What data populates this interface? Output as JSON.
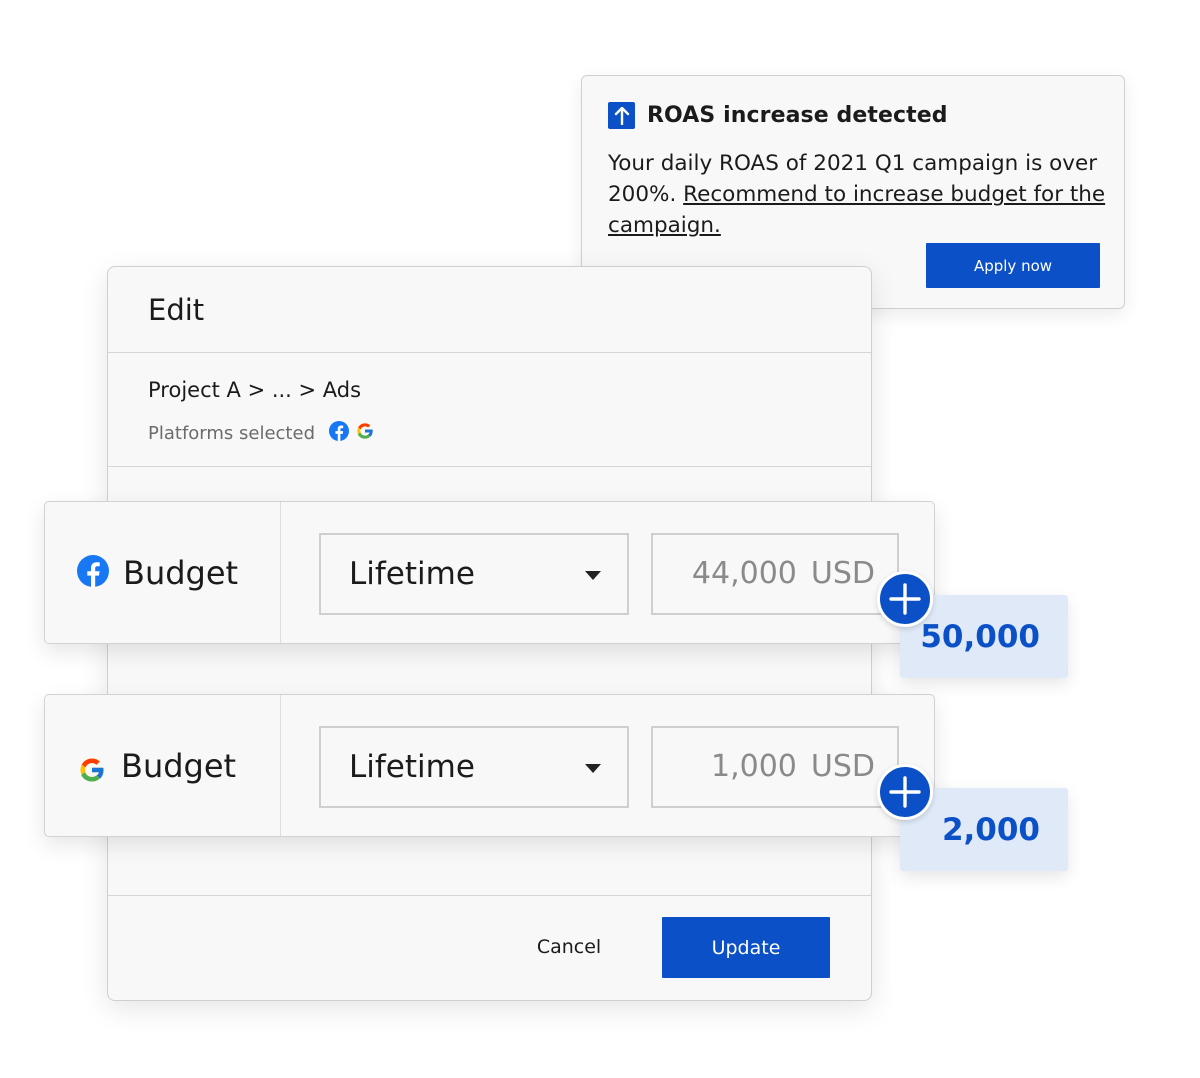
{
  "notification": {
    "title": "ROAS increase detected",
    "message": "Your daily ROAS of 2021 Q1 campaign is over 200%. ",
    "link_text": "Recommend to increase budget for the campaign.",
    "apply_label": "Apply now",
    "icon": "arrow-up-icon"
  },
  "edit": {
    "title": "Edit",
    "breadcrumb": "Project A > ... > Ads",
    "platforms_label": "Platforms selected",
    "cancel_label": "Cancel",
    "update_label": "Update"
  },
  "budgets": [
    {
      "platform_icon": "facebook-icon",
      "label": "Budget",
      "period": "Lifetime",
      "amount": "44,000",
      "currency": "USD",
      "suggested": "50,000"
    },
    {
      "platform_icon": "google-icon",
      "label": "Budget",
      "period": "Lifetime",
      "amount": "1,000",
      "currency": "USD",
      "suggested": "2,000"
    }
  ],
  "colors": {
    "accent": "#0b50c6",
    "chip_bg": "#dfe9f7",
    "panel_bg": "#f8f8f8",
    "facebook": "#1877f2"
  }
}
